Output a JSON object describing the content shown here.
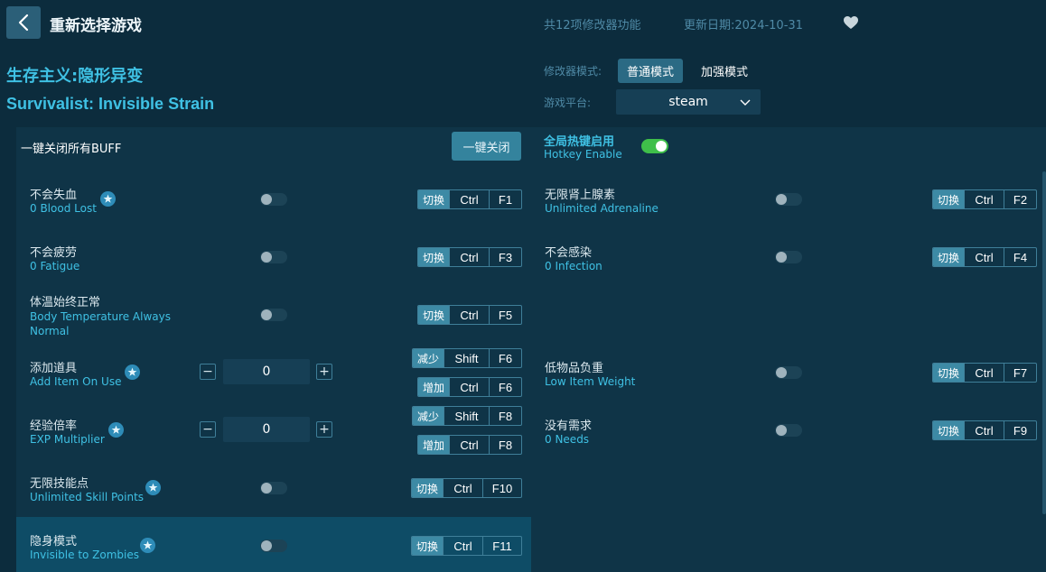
{
  "header": {
    "title": "重新选择游戏",
    "feature_count": "共12项修改器功能",
    "update_date": "更新日期:2024-10-31"
  },
  "game": {
    "title_cn": "生存主义:隐形异变",
    "title_en": "Survivalist: Invisible Strain"
  },
  "mode": {
    "label": "修改器模式:",
    "normal": "普通模式",
    "enhanced": "加强模式"
  },
  "platform": {
    "label": "游戏平台:",
    "value": "steam"
  },
  "buff": {
    "label": "一键关闭所有BUFF",
    "button": "一键关闭"
  },
  "hotkey": {
    "label_cn": "全局热键启用",
    "label_en": "Hotkey Enable"
  },
  "features": [
    {
      "cn": "不会失血",
      "en": "0 Blood Lost",
      "keys": [
        "切换",
        "Ctrl",
        "F1"
      ]
    },
    {
      "cn": "无限肾上腺素",
      "en": "Unlimited Adrenaline",
      "keys": [
        "切换",
        "Ctrl",
        "F2"
      ]
    },
    {
      "cn": "不会疲劳",
      "en": "0 Fatigue",
      "keys": [
        "切换",
        "Ctrl",
        "F3"
      ]
    },
    {
      "cn": "不会感染",
      "en": "0 Infection",
      "keys": [
        "切换",
        "Ctrl",
        "F4"
      ]
    },
    {
      "cn": "体温始终正常",
      "en": "Body Temperature Always",
      "en2": "Normal",
      "keys": [
        "切换",
        "Ctrl",
        "F5"
      ]
    },
    {
      "cn": "添加道具",
      "en": "Add Item On Use",
      "value": "0",
      "keys_dec": [
        "减少",
        "Shift",
        "F6"
      ],
      "keys_inc": [
        "增加",
        "Ctrl",
        "F6"
      ]
    },
    {
      "cn": "低物品负重",
      "en": "Low Item Weight",
      "keys": [
        "切换",
        "Ctrl",
        "F7"
      ]
    },
    {
      "cn": "经验倍率",
      "en": "EXP Multiplier",
      "value": "0",
      "keys_dec": [
        "减少",
        "Shift",
        "F8"
      ],
      "keys_inc": [
        "增加",
        "Ctrl",
        "F8"
      ]
    },
    {
      "cn": "没有需求",
      "en": "0 Needs",
      "keys": [
        "切换",
        "Ctrl",
        "F9"
      ]
    },
    {
      "cn": "无限技能点",
      "en": "Unlimited Skill Points",
      "keys": [
        "切换",
        "Ctrl",
        "F10"
      ]
    },
    {
      "cn": "隐身模式",
      "en": "Invisible to Zombies",
      "keys": [
        "切换",
        "Ctrl",
        "F11"
      ]
    }
  ],
  "icons": {
    "back": "chevron-left-icon",
    "favorite": "heart-icon",
    "star": "star-icon",
    "dropdown": "chevron-down-icon"
  },
  "colors": {
    "background": "#0c2c3d",
    "accent": "#3fc1e4",
    "toggle_on": "#3fbf4a"
  }
}
